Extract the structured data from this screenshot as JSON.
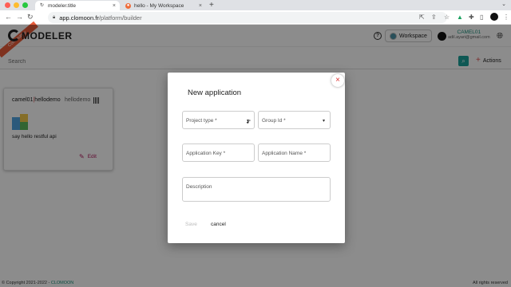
{
  "browser": {
    "tabs": [
      {
        "title": "modeler.title"
      },
      {
        "title": "hello - My Workspace"
      }
    ],
    "url_host": "app.clomoon.fr",
    "url_path": "/platform/builder",
    "window_controls": {
      "close_color": "#ff5f57",
      "minimize_color": "#febc2e",
      "maximize_color": "#28c840"
    }
  },
  "header": {
    "logo_text": "MODELER",
    "ribbon_text": "Community",
    "workspace_label": "Workspace",
    "user_name": "CAMEL01",
    "user_email": "adil.ayari@gmail.com"
  },
  "toolbar": {
    "search_placeholder": "Search",
    "actions_label": "Actions"
  },
  "card": {
    "title_prefix": "camel01",
    "title_suffix": "hellodemo",
    "workspace": "hellodemo",
    "description": "say hello restful api",
    "edit_label": "Edit"
  },
  "footer": {
    "copyright": "© Copyright 2021-2022 -",
    "brand": "CLOMOON",
    "rights": "All rights reserved"
  },
  "dialog": {
    "title": "New application",
    "fields": {
      "project_type": "Project type *",
      "group_id": "Group Id *",
      "application_key": "Application Key *",
      "application_name": "Application Name *",
      "description": "Description"
    },
    "save_label": "Save",
    "cancel_label": "cancel"
  },
  "colors": {
    "accent": "#1aa19a",
    "edit": "#b0165a",
    "close": "#dd3333",
    "ribbon": "#e85c3a"
  }
}
